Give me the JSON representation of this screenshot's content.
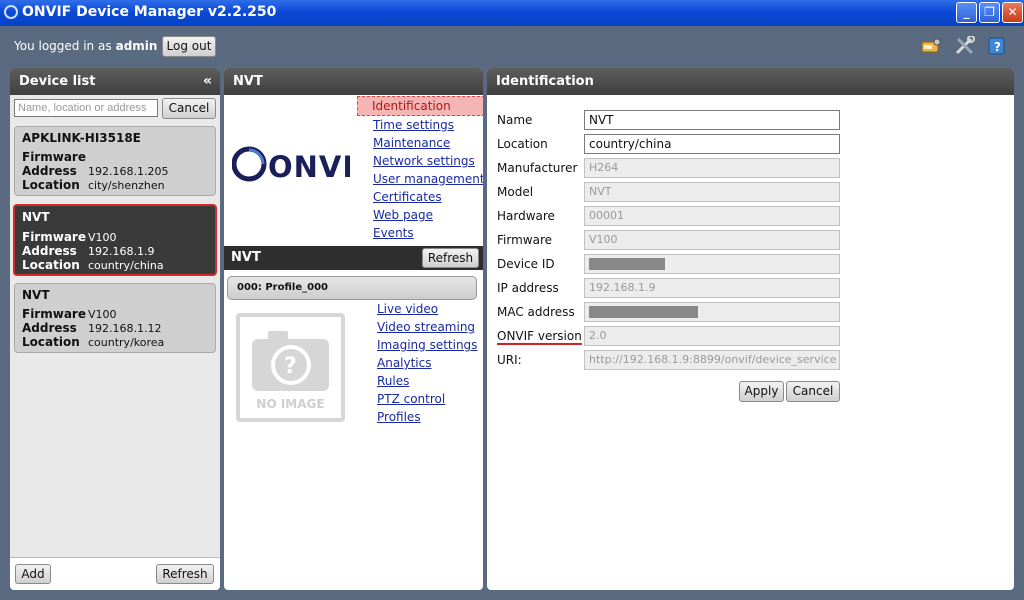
{
  "window": {
    "title": "ONVIF Device Manager v2.2.250",
    "minimize": "_",
    "restore": "❐",
    "close": "✕"
  },
  "topbar": {
    "logged_in_text": "You logged in as",
    "user": "admin",
    "logout_label": "Log out"
  },
  "device_list": {
    "title": "Device list",
    "collapse": "«",
    "search_placeholder": "Name, location or address",
    "cancel_label": "Cancel",
    "devices": [
      {
        "name": "APKLINK-HI3518E",
        "firmware_label": "Firmware",
        "firmware": "",
        "address_label": "Address",
        "address": "192.168.1.205",
        "location_label": "Location",
        "location": "city/shenzhen"
      },
      {
        "name": "NVT",
        "firmware_label": "Firmware",
        "firmware": "V100",
        "address_label": "Address",
        "address": "192.168.1.9",
        "location_label": "Location",
        "location": "country/china"
      },
      {
        "name": "NVT",
        "firmware_label": "Firmware",
        "firmware": "V100",
        "address_label": "Address",
        "address": "192.168.1.12",
        "location_label": "Location",
        "location": "country/korea"
      }
    ],
    "add_label": "Add",
    "refresh_label": "Refresh"
  },
  "nvt": {
    "title": "NVT",
    "logo_text": "ONVIF",
    "device_links": [
      "Identification",
      "Time settings",
      "Maintenance",
      "Network settings",
      "User management",
      "Certificates",
      "Web page",
      "Events"
    ],
    "bar_title": "NVT",
    "refresh_label": "Refresh",
    "profile": "000: Profile_000",
    "no_image": "NO IMAGE",
    "profile_links": [
      "Live video",
      "Video streaming",
      "Imaging settings",
      "Analytics",
      "Rules",
      "PTZ control",
      "Profiles"
    ]
  },
  "identification": {
    "title": "Identification",
    "fields": [
      {
        "label": "Name",
        "value": "NVT"
      },
      {
        "label": "Location",
        "value": "country/china"
      },
      {
        "label": "Manufacturer",
        "value": "H264"
      },
      {
        "label": "Model",
        "value": "NVT"
      },
      {
        "label": "Hardware",
        "value": "00001"
      },
      {
        "label": "Firmware",
        "value": "V100"
      },
      {
        "label": "Device ID",
        "value": ""
      },
      {
        "label": "IP address",
        "value": "192.168.1.9"
      },
      {
        "label": "MAC address",
        "value": ""
      },
      {
        "label": "ONVIF version",
        "value": "2.0"
      },
      {
        "label": "URI:",
        "value": "http://192.168.1.9:8899/onvif/device_service"
      }
    ],
    "apply_label": "Apply",
    "cancel_label": "Cancel"
  },
  "colors": {
    "accent_selected": "#d12b2b",
    "link": "#1a2aa0",
    "titlebar": "#0b4ad6"
  }
}
